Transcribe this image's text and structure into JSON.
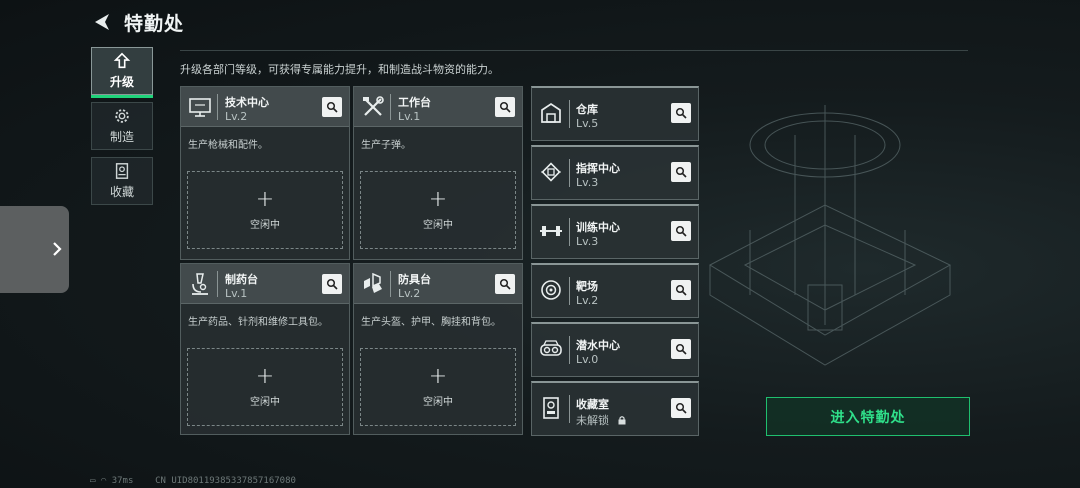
{
  "header": {
    "title": "特勤处"
  },
  "nav": [
    {
      "label": "升级",
      "icon": "upgrade-icon",
      "active": true
    },
    {
      "label": "制造",
      "icon": "gear-icon",
      "active": false
    },
    {
      "label": "收藏",
      "icon": "collection-icon",
      "active": false
    }
  ],
  "description": "升级各部门等级，可获得专属能力提升，和制造战斗物资的能力。",
  "departments": [
    {
      "name": "技术中心",
      "level": "Lv.2",
      "desc": "生产枪械和配件。",
      "slot_label": "空闲中",
      "icon": "computer-icon"
    },
    {
      "name": "工作台",
      "level": "Lv.1",
      "desc": "生产子弹。",
      "slot_label": "空闲中",
      "icon": "tools-icon"
    },
    {
      "name": "制药台",
      "level": "Lv.1",
      "desc": "生产药品、针剂和维修工具包。",
      "slot_label": "空闲中",
      "icon": "microscope-icon"
    },
    {
      "name": "防具台",
      "level": "Lv.2",
      "desc": "生产头盔、护甲、胸挂和背包。",
      "slot_label": "空闲中",
      "icon": "armor-icon"
    }
  ],
  "side_departments": [
    {
      "name": "仓库",
      "level": "Lv.5",
      "icon": "warehouse-icon"
    },
    {
      "name": "指挥中心",
      "level": "Lv.3",
      "icon": "chip-icon"
    },
    {
      "name": "训练中心",
      "level": "Lv.3",
      "icon": "dumbbell-icon"
    },
    {
      "name": "靶场",
      "level": "Lv.2",
      "icon": "target-icon"
    },
    {
      "name": "潜水中心",
      "level": "Lv.0",
      "icon": "diving-mask-icon"
    },
    {
      "name": "收藏室",
      "level": "未解锁",
      "icon": "trophy-icon",
      "locked": true
    }
  ],
  "slot_plus": "+",
  "enter_button": "进入特勤处",
  "status": {
    "ping": "37ms",
    "uid": "CN UID801193853378571670​80"
  },
  "colors": {
    "accent": "#1fd37a",
    "bg": "#141b1d"
  }
}
